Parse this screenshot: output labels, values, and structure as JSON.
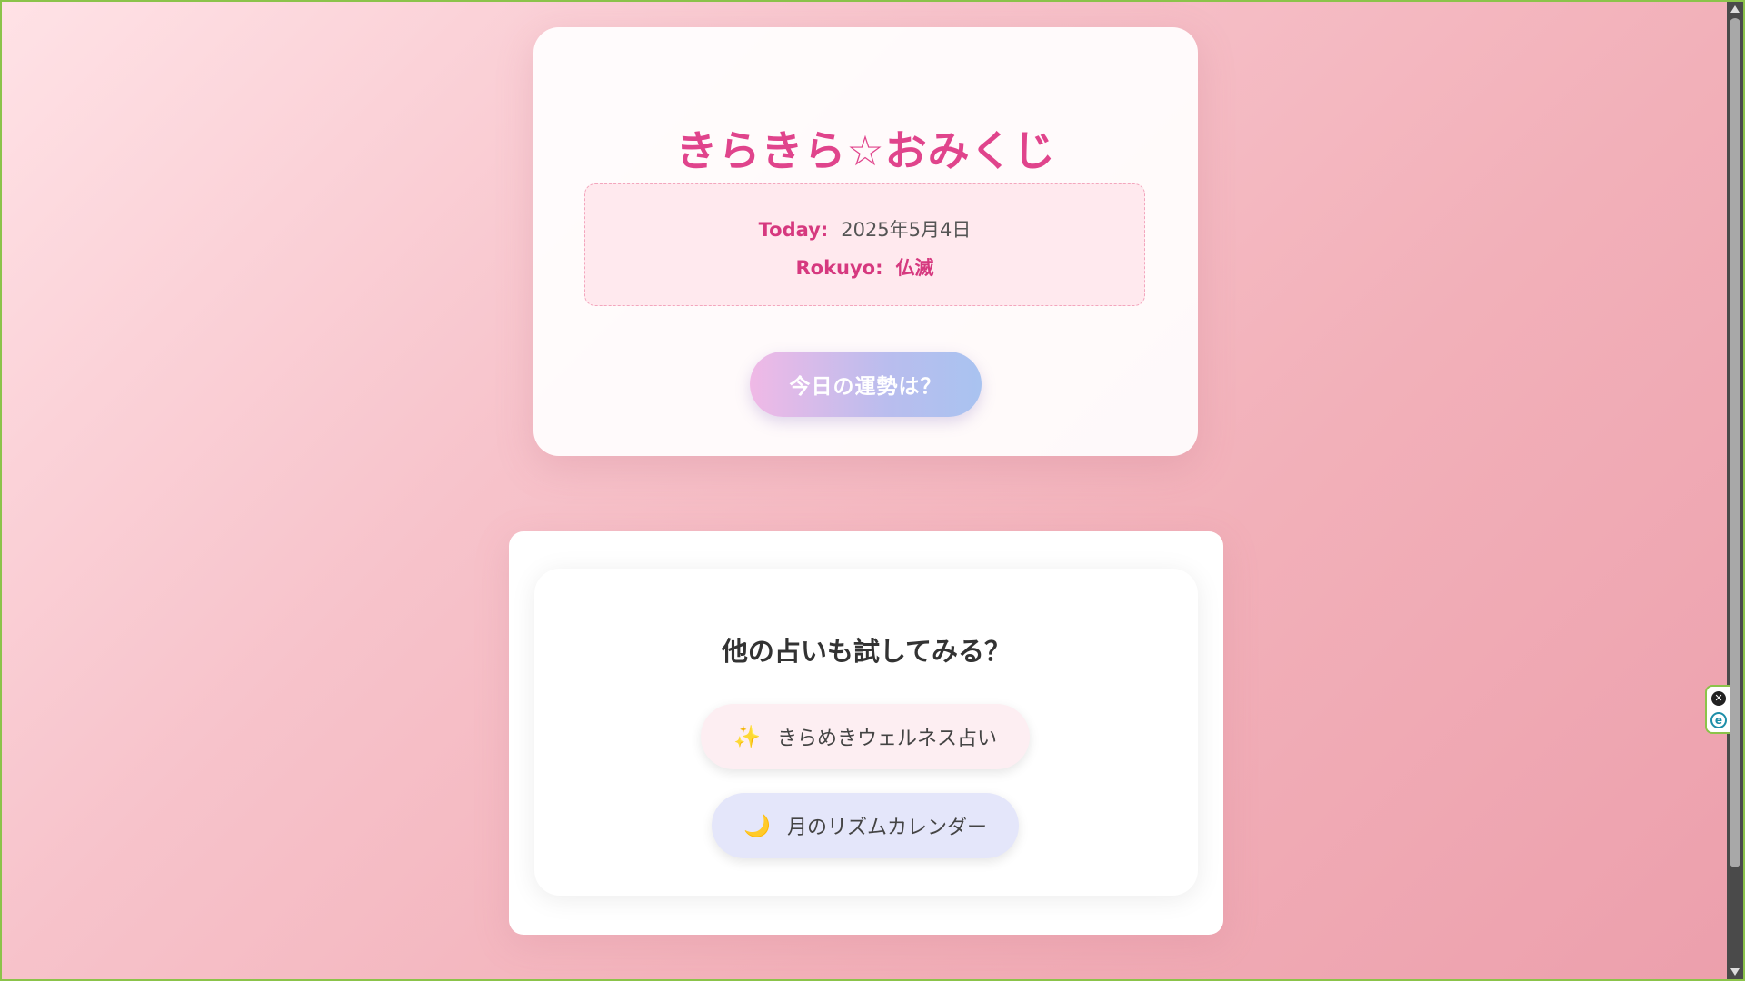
{
  "omikuji": {
    "title": "きらきら☆おみくじ",
    "today_label": "Today:",
    "today_value": "2025年5月4日",
    "rokuyo_label": "Rokuyo:",
    "rokuyo_value": "仏滅",
    "fortune_button": "今日の運勢は？"
  },
  "other": {
    "heading": "他の占いも試してみる？",
    "links": [
      {
        "emoji": "✨",
        "label": "きらめきウェルネス占い"
      },
      {
        "emoji": "🌙",
        "label": "月のリズムカレンダー"
      }
    ]
  },
  "extension": {
    "close_glyph": "✕",
    "icon_glyph": "e"
  },
  "colors": {
    "accent": "#e0448c",
    "background_start": "#ffe2e6",
    "background_end": "#ec9fac"
  }
}
